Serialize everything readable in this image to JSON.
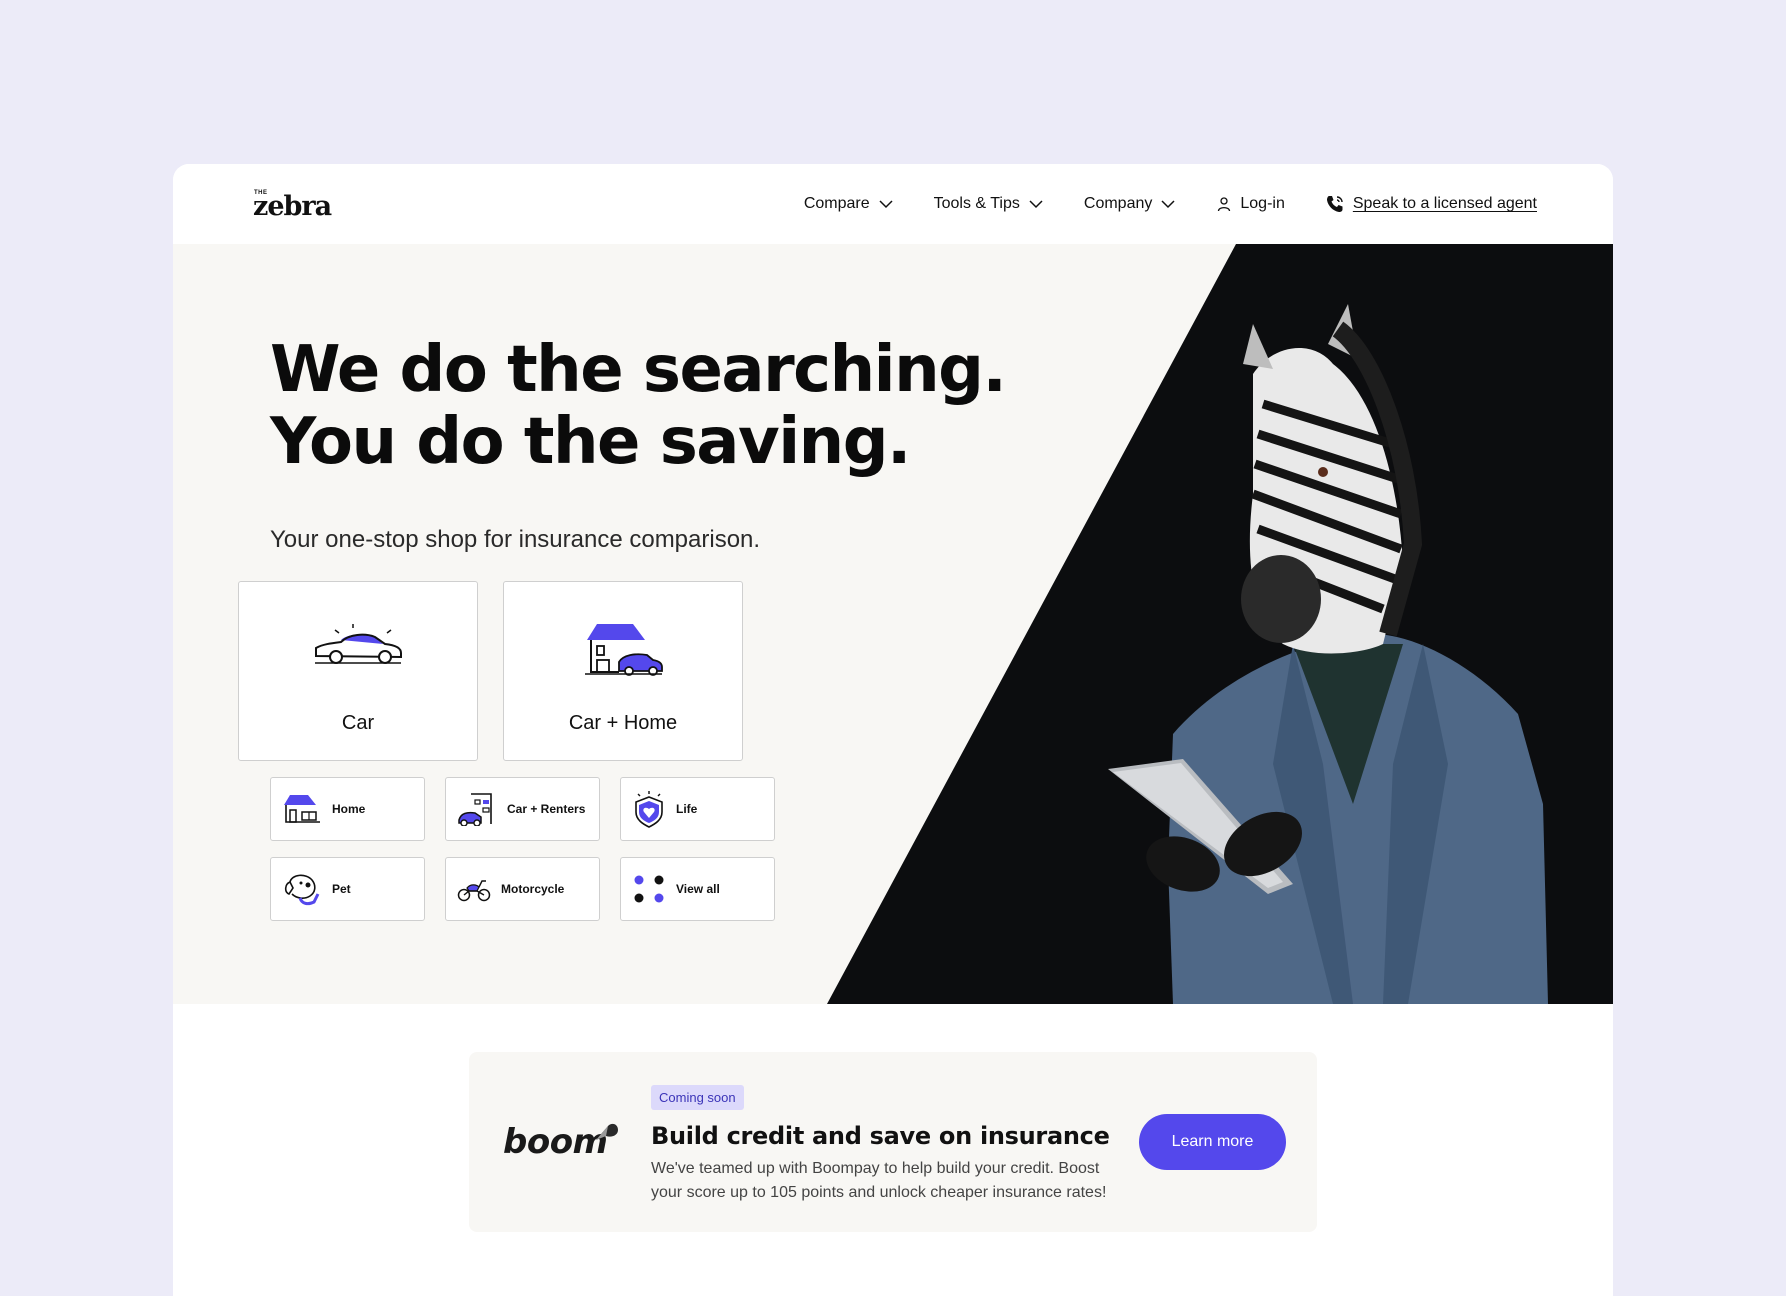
{
  "brand": {
    "small": "THE",
    "name": "zebra"
  },
  "nav": {
    "compare": "Compare",
    "tools": "Tools & Tips",
    "company": "Company",
    "login": "Log-in",
    "agent": "Speak to a licensed agent"
  },
  "hero": {
    "line1": "We do the searching.",
    "line2": "You do the saving.",
    "subtitle": "Your one-stop shop for insurance comparison.",
    "big_cards": [
      {
        "label": "Car",
        "icon": "car-icon"
      },
      {
        "label": "Car + Home",
        "icon": "house-car-icon"
      }
    ],
    "small_cards": [
      {
        "label": "Home",
        "icon": "home-icon"
      },
      {
        "label": "Car + Renters",
        "icon": "building-car-icon"
      },
      {
        "label": "Life",
        "icon": "shield-heart-icon"
      },
      {
        "label": "Pet",
        "icon": "dog-icon"
      },
      {
        "label": "Motorcycle",
        "icon": "motorcycle-icon"
      },
      {
        "label": "View all",
        "icon": "dots-grid-icon"
      }
    ],
    "image": "zebra-in-suit-with-tablet"
  },
  "banner": {
    "logo_text": "boom",
    "badge": "Coming soon",
    "title": "Build credit and save on insurance",
    "text": "We've teamed up with Boompay to help build your credit. Boost your score up to 105 points and unlock cheaper insurance rates!",
    "button": "Learn more"
  },
  "colors": {
    "accent": "#5448ec",
    "page_bg": "#ecebf8",
    "hero_bg": "#f8f7f4",
    "hero_dark": "#0c0d0f"
  }
}
